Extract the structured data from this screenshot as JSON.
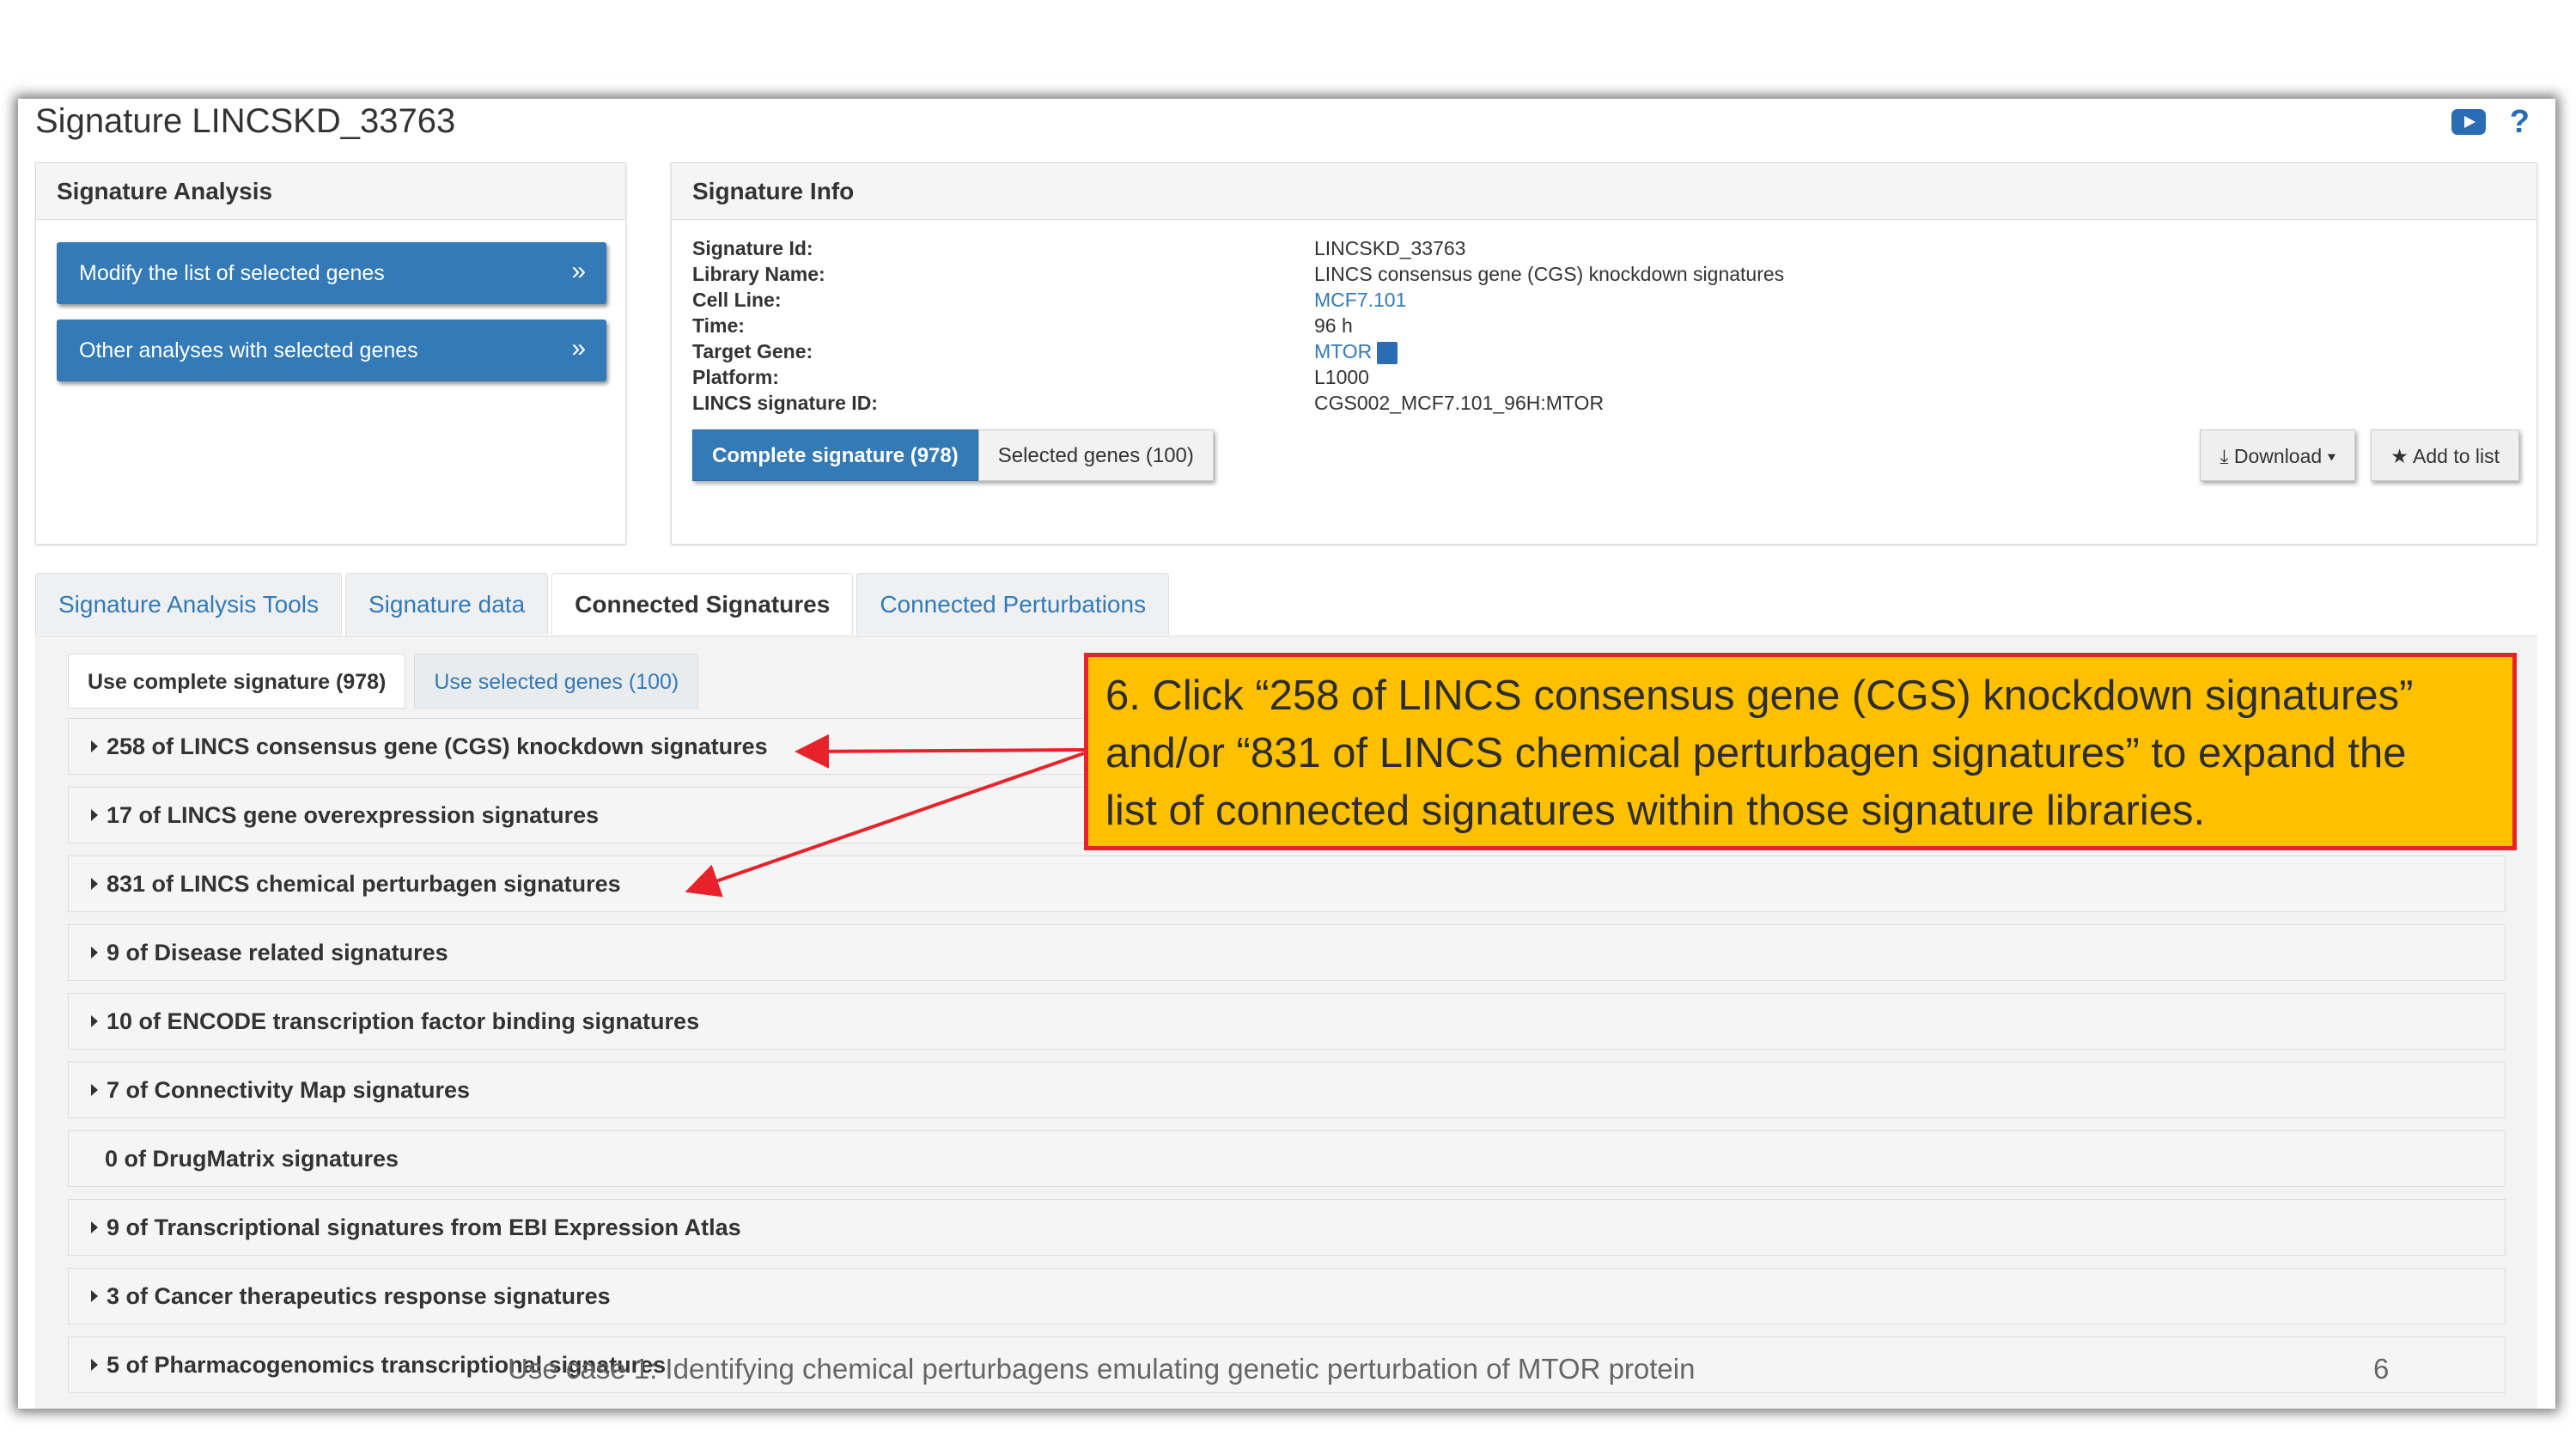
{
  "page_title": "Signature LINCSKD_33763",
  "analysis_panel": {
    "heading": "Signature Analysis",
    "buttons": [
      {
        "label": "Modify the list of selected genes",
        "chevron": "»"
      },
      {
        "label": "Other analyses with selected genes",
        "chevron": "»"
      }
    ]
  },
  "info_panel": {
    "heading": "Signature Info",
    "rows": [
      {
        "label": "Signature Id:",
        "value": "LINCSKD_33763"
      },
      {
        "label": "Library Name:",
        "value": "LINCS consensus gene (CGS) knockdown signatures"
      },
      {
        "label": "Cell Line:",
        "value": "MCF7.101"
      },
      {
        "label": "Time:",
        "value": "96 h"
      },
      {
        "label": "Target Gene:",
        "value": "MTOR"
      },
      {
        "label": "Platform:",
        "value": "L1000"
      },
      {
        "label": "LINCS signature ID:",
        "value": "CGS002_MCF7.101_96H:MTOR"
      }
    ],
    "toggle": {
      "active": "Complete signature (978)",
      "inactive": "Selected genes (100)"
    },
    "download_label": "Download",
    "add_to_list_label": "Add to list"
  },
  "main_tabs": [
    "Signature Analysis Tools",
    "Signature data",
    "Connected Signatures",
    "Connected Perturbations"
  ],
  "sub_tabs": [
    "Use complete signature (978)",
    "Use selected genes (100)"
  ],
  "signature_rows": [
    "258 of LINCS consensus gene (CGS) knockdown signatures",
    "17 of LINCS gene overexpression signatures",
    "831 of LINCS chemical perturbagen signatures",
    "9 of Disease related signatures",
    "10 of ENCODE transcription factor binding signatures",
    "7 of Connectivity Map signatures",
    "0 of DrugMatrix signatures",
    "9 of Transcriptional signatures from EBI Expression Atlas",
    "3 of Cancer therapeutics response signatures",
    "5 of Pharmacogenomics transcriptional signatures"
  ],
  "callout": {
    "line1": "6. Click “258 of LINCS consensus gene (CGS) knockdown signatures”",
    "line2": "and/or “831 of LINCS chemical perturbagen signatures” to expand the",
    "line3": "list of connected signatures within those signature libraries."
  },
  "footer": {
    "caption": "Use case 1: Identifying chemical perturbagens emulating genetic perturbation of MTOR protein",
    "page_number": "6"
  },
  "colors": {
    "accent": "#337ab7",
    "callout_fill": "#ffc000",
    "callout_border": "#e8222a",
    "arrow": "#e8222a"
  },
  "icons": [
    "youtube-icon",
    "help-icon",
    "gene-card-icon",
    "download-icon",
    "star-icon",
    "caret-right-icon",
    "chevron-double-right-icon"
  ]
}
